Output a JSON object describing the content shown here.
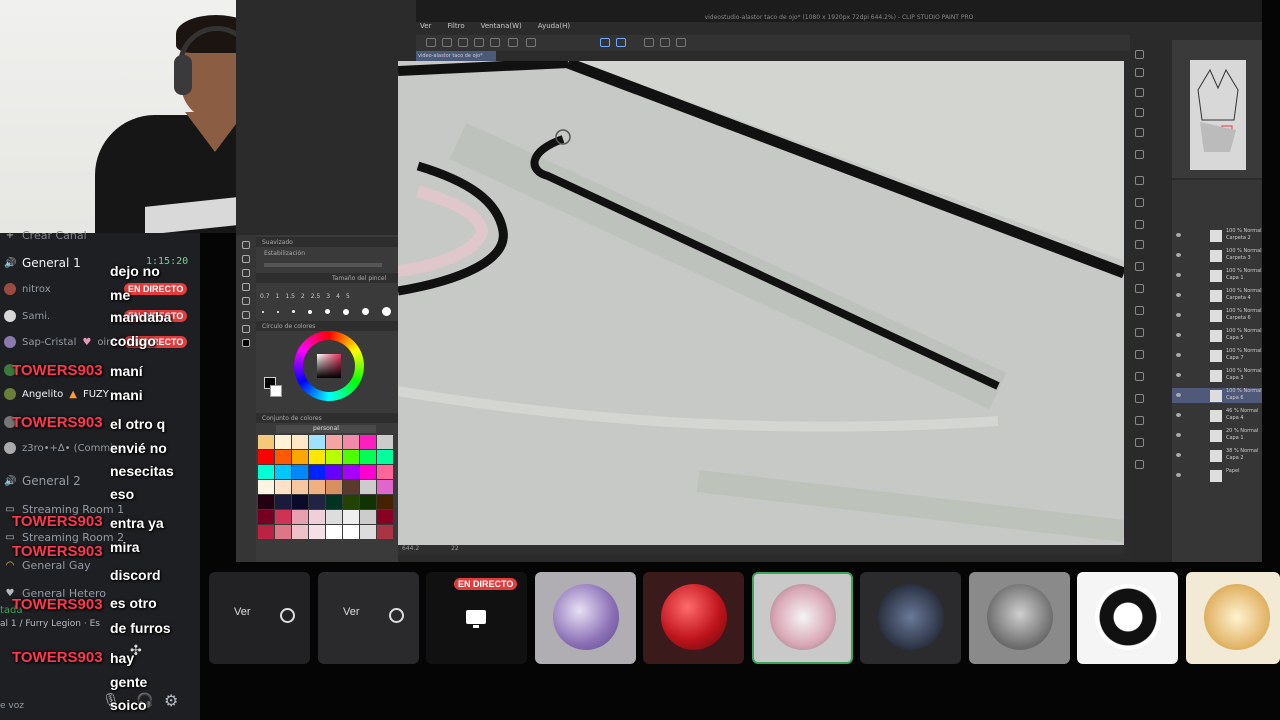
{
  "app": {
    "window_title": "videostudio-alastor taco de ojo* (1080 x 1920px 72dpi 644.2%) - CLIP STUDIO PAINT PRO",
    "menu": [
      "Ver",
      "Filtro",
      "Ventana(W)",
      "Ayuda(H)"
    ],
    "canvas_tab": "video-alastor taco de ojo*",
    "status_zoom": "644.2",
    "status_value": "22"
  },
  "tool_panel": {
    "subtool_title": "Suavizado",
    "stabilization_label": "Estabilización",
    "brush_size_label": "Tamaño del pincel",
    "brush_sizes": [
      "0.7",
      "1",
      "1.5",
      "2",
      "2.5",
      "3",
      "4",
      "5"
    ],
    "color_wheel_label": "Círculo de colores",
    "palette_label": "Conjunto de colores",
    "palette_name": "personal"
  },
  "layers": {
    "rows": [
      "100 % Normal Carpeta 2",
      "100 % Normal Carpeta 3",
      "100 % Normal Capa 1",
      "100 % Normal Carpeta 4",
      "100 % Normal Carpeta 6",
      "100 % Normal Capa 5",
      "100 % Normal Capa 7",
      "100 % Normal Capa 3",
      "100 % Normal Capa 6",
      "46 % Normal Capa 4",
      "20 % Normal Capa 1",
      "38 % Normal Capa 2",
      "Papel"
    ]
  },
  "sidebar": {
    "create_channel": "Crear Canal",
    "voice_channel": "General 1",
    "timer": "1:15:20",
    "members": [
      {
        "name": "nitrox",
        "live": true
      },
      {
        "name": "Sami.",
        "live": true
      },
      {
        "name": "Sap-Cristal",
        "tag": "oink",
        "live": true
      },
      {
        "name": "",
        "live": false
      },
      {
        "name": "Angelito",
        "tag": "FUZY",
        "live": false
      },
      {
        "name": "",
        "live": false
      },
      {
        "name": "z3ro•+∆• (Commiss",
        "live": false
      }
    ],
    "live_label": "EN DIRECTO",
    "channels": [
      "General 2",
      "Streaming Room 1",
      "Streaming Room 2",
      "General Gay",
      "General Hetero"
    ],
    "bottom_left": "tada",
    "bottom_channel": "al 1 / Furry Legion · Es",
    "voice_status": "e voz"
  },
  "chat": {
    "username": "TOWERS903",
    "messages": [
      {
        "text": "dejo no",
        "top": -1
      },
      {
        "text": "me"
      },
      {
        "text": "mandaba"
      },
      {
        "text": "codigo"
      },
      {
        "text": "maní"
      },
      {
        "text": "mani"
      },
      {
        "text": "el otro q"
      },
      {
        "text": "envié no"
      },
      {
        "text": "nesecitas"
      },
      {
        "text": "eso"
      },
      {
        "text": "entra ya"
      },
      {
        "text": "mira"
      },
      {
        "text": "discord"
      },
      {
        "text": "es otro"
      },
      {
        "text": "de furros"
      },
      {
        "text": "hay"
      },
      {
        "text": "gente"
      },
      {
        "text": "soico"
      }
    ]
  },
  "streams": {
    "view_label": "Ver",
    "live_label": "EN DIRECTO"
  },
  "colors": {
    "live_red": "#e23c3c",
    "chat_user_red": "#ff3850",
    "canvas_bg": "#c8cbc7",
    "discord_bg": "#1e1f22"
  }
}
